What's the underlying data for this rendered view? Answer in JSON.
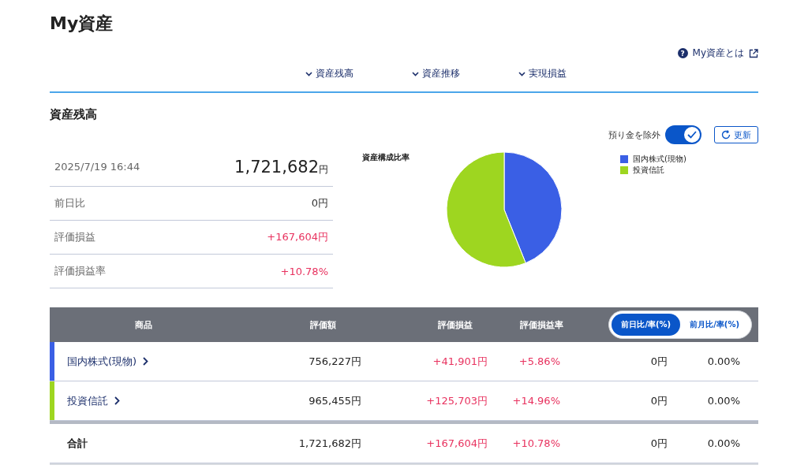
{
  "page_title": "My資産",
  "help_icon": "?",
  "help_link": "My資産とは",
  "nav": [
    {
      "label": "資産残高"
    },
    {
      "label": "資産推移"
    },
    {
      "label": "実現損益"
    }
  ],
  "section_title": "資産残高",
  "toggle": {
    "label": "預り金を除外",
    "on": true
  },
  "refresh_button": "更新",
  "summary": {
    "datetime": "2025/7/19 16:44",
    "total": "1,721,682",
    "total_unit": "円",
    "rows": [
      {
        "label": "前日比",
        "value": "0円",
        "positive": false
      },
      {
        "label": "評価損益",
        "value": "+167,604円",
        "positive": true
      },
      {
        "label": "評価損益率",
        "value": "+10.78%",
        "positive": true
      }
    ]
  },
  "chart": {
    "title": "資産構成比率",
    "chart_data": {
      "type": "pie",
      "categories": [
        "国内株式(現物)",
        "投資信託"
      ],
      "values": [
        43.92,
        56.08
      ],
      "colors": [
        "#3a5fe5",
        "#9ed620"
      ]
    }
  },
  "table": {
    "columns": [
      "商品",
      "評価額",
      "評価損益",
      "評価損益率"
    ],
    "period_toggle": [
      {
        "label": "前日比/率(%)",
        "selected": true
      },
      {
        "label": "前月比/率(%)",
        "selected": false
      }
    ],
    "rows": [
      {
        "name": "国内株式(現物)",
        "color": "#3a5fe5",
        "amount": "756,227円",
        "gain": "+41,901円",
        "gain_rate": "+5.86%",
        "change": "0円",
        "change_rate": "0.00%"
      },
      {
        "name": "投資信託",
        "color": "#9ed620",
        "amount": "965,455円",
        "gain": "+125,703円",
        "gain_rate": "+14.96%",
        "change": "0円",
        "change_rate": "0.00%"
      }
    ],
    "total": {
      "name": "合計",
      "amount": "1,721,682円",
      "gain": "+167,604円",
      "gain_rate": "+10.78%",
      "change": "0円",
      "change_rate": "0.00%"
    }
  }
}
